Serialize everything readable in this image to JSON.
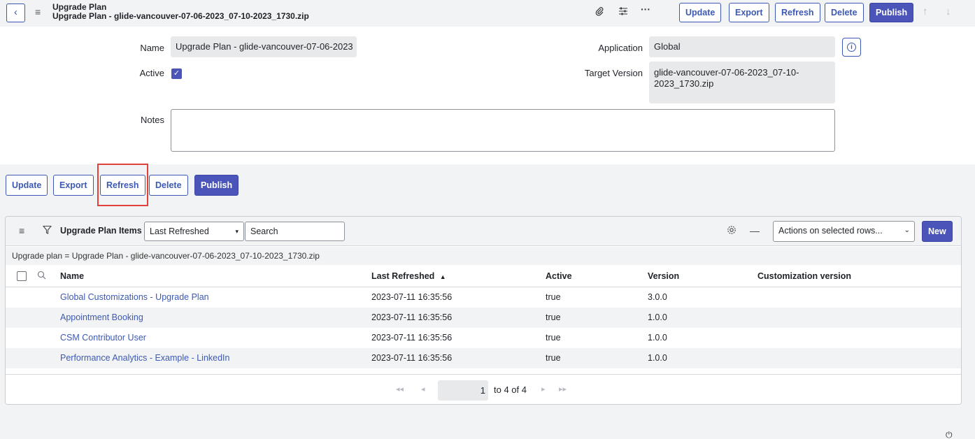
{
  "header": {
    "title_line1": "Upgrade Plan",
    "title_line2": "Upgrade Plan - glide-vancouver-07-06-2023_07-10-2023_1730.zip",
    "icons": {
      "back": "chevron-left-icon",
      "menu": "hamburger-icon",
      "attach": "paperclip-icon",
      "settings": "sliders-icon",
      "more": "more-icon",
      "up": "arrow-up-icon",
      "down": "arrow-down-icon"
    },
    "buttons": {
      "update": "Update",
      "export": "Export",
      "refresh": "Refresh",
      "delete": "Delete",
      "publish": "Publish"
    }
  },
  "form": {
    "name_label": "Name",
    "name_value": "Upgrade Plan - glide-vancouver-07-06-2023",
    "active_label": "Active",
    "active_checked": true,
    "notes_label": "Notes",
    "notes_value": "",
    "application_label": "Application",
    "application_value": "Global",
    "target_version_label": "Target Version",
    "target_version_line1": "glide-vancouver-07-06-2023_07-10-",
    "target_version_line2": "2023_1730.zip"
  },
  "bottom_buttons": {
    "update": "Update",
    "export": "Export",
    "refresh": "Refresh",
    "delete": "Delete",
    "publish": "Publish"
  },
  "list": {
    "title": "Upgrade Plan Items",
    "sort_select": "Last Refreshed",
    "search_placeholder": "Search",
    "actions_select": "Actions on selected rows...",
    "new_button": "New",
    "filter_text": "Upgrade plan = Upgrade Plan - glide-vancouver-07-06-2023_07-10-2023_1730.zip",
    "columns": [
      "Name",
      "Last Refreshed",
      "Active",
      "Version",
      "Customization version"
    ],
    "sort_indicator": "▲",
    "rows": [
      {
        "name": "Global Customizations - Upgrade Plan",
        "last_refreshed": "2023-07-11 16:35:56",
        "active": "true",
        "version": "3.0.0",
        "customization_version": ""
      },
      {
        "name": "Appointment Booking",
        "last_refreshed": "2023-07-11 16:35:56",
        "active": "true",
        "version": "1.0.0",
        "customization_version": ""
      },
      {
        "name": "CSM Contributor User",
        "last_refreshed": "2023-07-11 16:35:56",
        "active": "true",
        "version": "1.0.0",
        "customization_version": ""
      },
      {
        "name": "Performance Analytics - Example - LinkedIn",
        "last_refreshed": "2023-07-11 16:35:56",
        "active": "true",
        "version": "1.0.0",
        "customization_version": ""
      }
    ],
    "pagination": {
      "current": "1",
      "range_text": "to 4 of 4"
    }
  }
}
